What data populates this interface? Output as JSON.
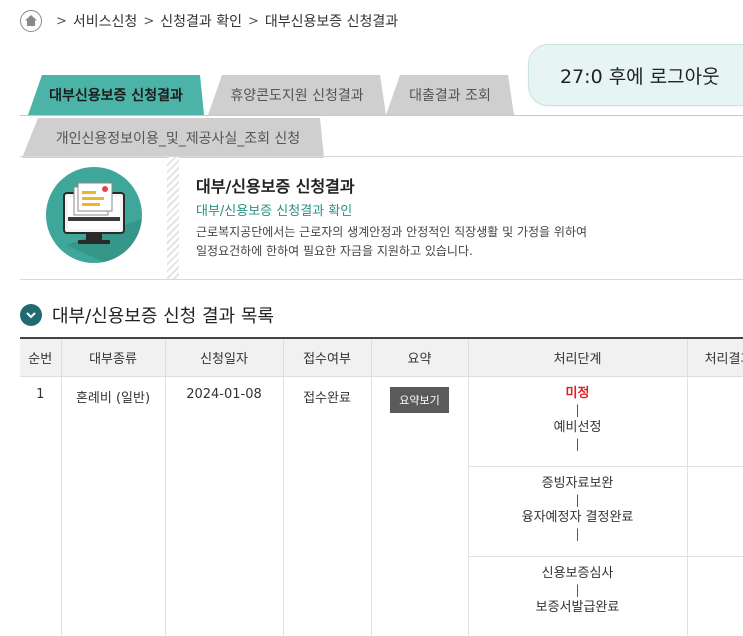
{
  "breadcrumb": {
    "items": [
      "서비스신청",
      "신청결과 확인",
      "대부신용보증 신청결과"
    ],
    "separator": ">"
  },
  "timer": {
    "text": "27:0 후에 로그아웃"
  },
  "tabs": [
    {
      "label": "대부신용보증 신청결과",
      "active": true
    },
    {
      "label": "휴양콘도지원 신청결과",
      "active": false
    },
    {
      "label": "대출결과 조회",
      "active": false
    },
    {
      "label": "개인신용정보이용_및_제공사실_조회 신청",
      "active": false
    }
  ],
  "info": {
    "title": "대부/신용보증 신청결과",
    "subtitle": "대부/신용보증 신청결과 확인",
    "desc_line1": "근로복지공단에서는 근로자의 생계안정과 안정적인 직장생활 및 가정을 위하여",
    "desc_line2": "일정요건하에 한하여 필요한 자금을 지원하고 있습니다."
  },
  "section": {
    "title": "대부/신용보증 신청 결과 목록"
  },
  "table": {
    "headers": [
      "순번",
      "대부종류",
      "신청일자",
      "접수여부",
      "요약",
      "처리단계",
      "처리결과"
    ],
    "row": {
      "no": "1",
      "type": "혼례비 (일반)",
      "date": "2024-01-08",
      "status": "접수완료",
      "summary_button": "요약보기",
      "stages": [
        {
          "top": "미정",
          "bottom": "예비선정",
          "top_highlight": true
        },
        {
          "top": "증빙자료보완",
          "bottom": "융자예정자 결정완료",
          "top_highlight": false
        },
        {
          "top": "신용보증심사",
          "bottom": "보증서발급완료",
          "top_highlight": false
        }
      ],
      "stage_divider": "|",
      "result": ""
    }
  },
  "colors": {
    "accent": "#4bb3a7",
    "accent_dark": "#1f6b70",
    "tab_inactive": "#cfcfcf",
    "highlight_red": "#e02020",
    "timer_bg": "#e6f4f3"
  }
}
